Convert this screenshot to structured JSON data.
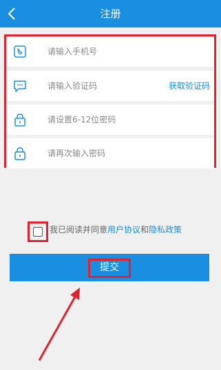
{
  "header": {
    "title": "注册",
    "back_icon": "chevron-left-icon"
  },
  "form": {
    "phone": {
      "placeholder": "请输入手机号",
      "icon": "phone-icon"
    },
    "code": {
      "placeholder": "请输入验证码",
      "icon": "message-icon",
      "action": "获取验证码"
    },
    "password": {
      "placeholder": "请设置6-12位密码",
      "icon": "lock-icon"
    },
    "confirm": {
      "placeholder": "请再次输入密码",
      "icon": "lock-icon"
    }
  },
  "agreement": {
    "prefix": "我已阅读并同意",
    "user_agreement": "用户协议",
    "and": "和",
    "privacy_policy": "隐私政策",
    "checked": false
  },
  "submit": {
    "label": "提交"
  },
  "colors": {
    "brand": "#1a8fe1",
    "highlight": "#e0232e",
    "background": "#f0f0f0"
  }
}
